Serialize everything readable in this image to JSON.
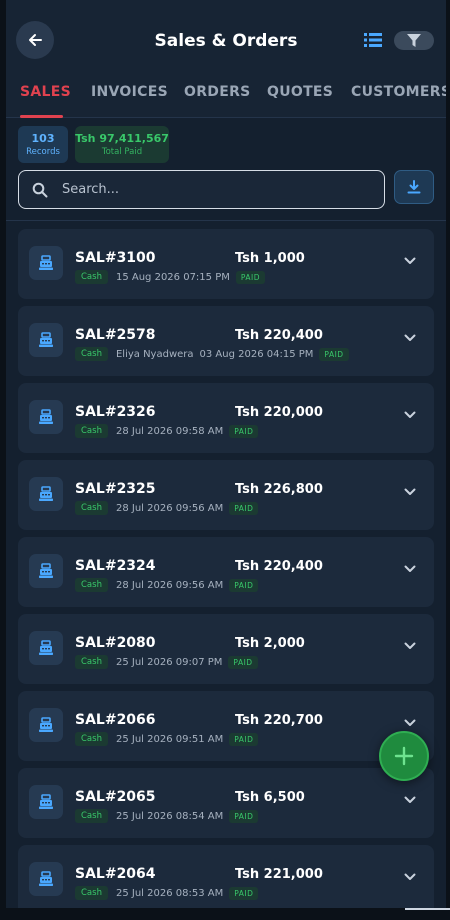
{
  "header": {
    "title": "Sales & Orders"
  },
  "tabs": [
    {
      "label": "SALES",
      "active": true
    },
    {
      "label": "INVOICES",
      "active": false
    },
    {
      "label": "ORDERS",
      "active": false
    },
    {
      "label": "QUOTES",
      "active": false
    },
    {
      "label": "CUSTOMERS",
      "active": false
    }
  ],
  "stats": {
    "records_value": "103",
    "records_label": "Records",
    "paid_value": "Tsh 97,411,567",
    "paid_label": "Total Paid"
  },
  "search": {
    "placeholder": "Search...",
    "value": ""
  },
  "colors": {
    "accent": "#e0424f",
    "paid_green": "#39c86a",
    "info_blue": "#5fb3ff",
    "background": "#14202f",
    "card": "#1c2a3c"
  },
  "sales": [
    {
      "id": "SAL#3100",
      "amount": "Tsh 1,000",
      "method": "Cash",
      "customer": "",
      "datetime": "15 Aug 2026  07:15 PM",
      "status": "PAID"
    },
    {
      "id": "SAL#2578",
      "amount": "Tsh 220,400",
      "method": "Cash",
      "customer": "Eliya Nyadwera",
      "datetime": "03 Aug 2026  04:15 PM",
      "status": "PAID"
    },
    {
      "id": "SAL#2326",
      "amount": "Tsh 220,000",
      "method": "Cash",
      "customer": "",
      "datetime": "28 Jul 2026  09:58 AM",
      "status": "PAID"
    },
    {
      "id": "SAL#2325",
      "amount": "Tsh 226,800",
      "method": "Cash",
      "customer": "",
      "datetime": "28 Jul 2026  09:56 AM",
      "status": "PAID"
    },
    {
      "id": "SAL#2324",
      "amount": "Tsh 220,400",
      "method": "Cash",
      "customer": "",
      "datetime": "28 Jul 2026  09:56 AM",
      "status": "PAID"
    },
    {
      "id": "SAL#2080",
      "amount": "Tsh 2,000",
      "method": "Cash",
      "customer": "",
      "datetime": "25 Jul 2026  09:07 PM",
      "status": "PAID"
    },
    {
      "id": "SAL#2066",
      "amount": "Tsh 220,700",
      "method": "Cash",
      "customer": "",
      "datetime": "25 Jul 2026  09:51 AM",
      "status": "PAID"
    },
    {
      "id": "SAL#2065",
      "amount": "Tsh 6,500",
      "method": "Cash",
      "customer": "",
      "datetime": "25 Jul 2026  08:54 AM",
      "status": "PAID"
    },
    {
      "id": "SAL#2064",
      "amount": "Tsh 221,000",
      "method": "Cash",
      "customer": "",
      "datetime": "25 Jul 2026  08:53 AM",
      "status": "PAID"
    }
  ],
  "icons": {
    "back": "arrow-left-icon",
    "list_view": "list-view-icon",
    "filter": "filter-icon",
    "search": "search-icon",
    "download": "download-icon",
    "register": "cash-register-icon",
    "expand": "chevron-down-icon",
    "add": "plus-icon"
  }
}
